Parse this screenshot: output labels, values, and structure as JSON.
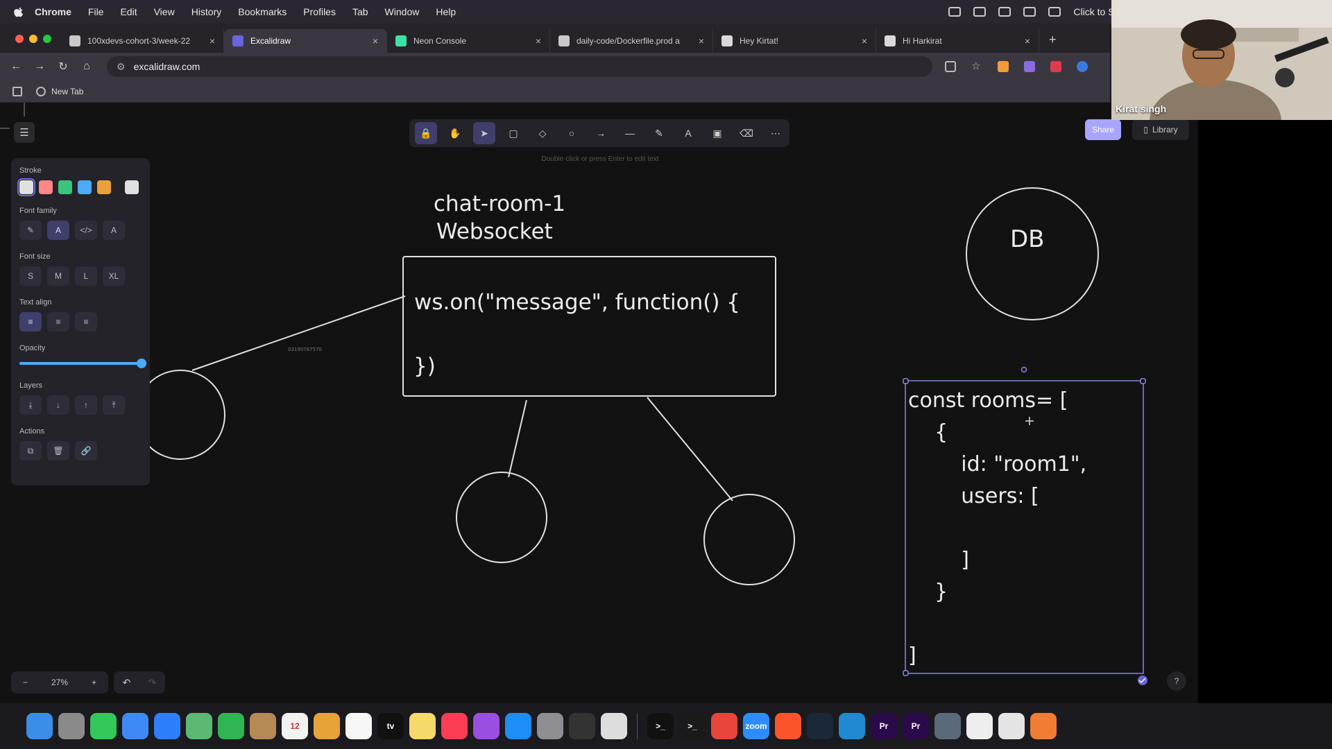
{
  "menubar": {
    "app": "Chrome",
    "items": [
      "File",
      "Edit",
      "View",
      "History",
      "Bookmarks",
      "Profiles",
      "Tab",
      "Window",
      "Help"
    ],
    "sign_in": "Click to Sign in"
  },
  "tabs": [
    {
      "title": "100xdevs-cohort-3/week-22",
      "fav": "#c9c9c9",
      "active": false
    },
    {
      "title": "Excalidraw",
      "fav": "#6965db",
      "active": true
    },
    {
      "title": "Neon Console",
      "fav": "#3ee0a8",
      "active": false
    },
    {
      "title": "daily-code/Dockerfile.prod a",
      "fav": "#c9c9c9",
      "active": false
    },
    {
      "title": "Hey Kirtat!",
      "fav": "#d9d9d9",
      "active": false
    },
    {
      "title": "Hi Harkirat",
      "fav": "#d9d9d9",
      "active": false
    }
  ],
  "address": {
    "url": "excalidraw.com"
  },
  "bookmarks": {
    "item": "New Tab"
  },
  "toolbar": {
    "hint": "Double-click or press Enter to edit text",
    "tools": [
      "lock",
      "hand",
      "selection",
      "rectangle",
      "diamond",
      "ellipse",
      "arrow",
      "line",
      "draw",
      "text",
      "image",
      "eraser",
      "more"
    ]
  },
  "top_right": {
    "share": "Share",
    "library": "Library"
  },
  "properties": {
    "stroke_label": "Stroke",
    "stroke_colors": [
      "#e0e0e0",
      "#ff8787",
      "#3bc47b",
      "#4dabf7",
      "#e8a13c",
      "#e0e0e0"
    ],
    "font_family_label": "Font family",
    "font_size_label": "Font size",
    "font_sizes": [
      "S",
      "M",
      "L",
      "XL"
    ],
    "text_align_label": "Text align",
    "opacity_label": "Opacity",
    "opacity_value": 1.0,
    "layers_label": "Layers",
    "actions_label": "Actions"
  },
  "canvas": {
    "title_line1": "chat-room-1",
    "title_line2": "Websocket",
    "code_line1": "ws.on(\"message\", function() {",
    "code_line2": "})",
    "db_label": "DB",
    "rooms_code": [
      "const rooms= [",
      "    {",
      "        id: \"room1\",",
      "        users: [",
      "",
      "        ]",
      "    }",
      "",
      "]"
    ],
    "tiny_label": "03190767570"
  },
  "bottom": {
    "zoom": "27%",
    "zoom_out": "−",
    "zoom_in": "+",
    "help": "?"
  },
  "webcam": {
    "name": "Kirat singh"
  },
  "dock": {
    "apps": [
      {
        "name": "finder",
        "color": "#3a8ee6",
        "glyph": ""
      },
      {
        "name": "launchpad",
        "color": "#8a8a8a",
        "glyph": ""
      },
      {
        "name": "messages",
        "color": "#34c759",
        "glyph": ""
      },
      {
        "name": "mail",
        "color": "#3d8af7",
        "glyph": ""
      },
      {
        "name": "safari",
        "color": "#2d7ff9",
        "glyph": ""
      },
      {
        "name": "maps",
        "color": "#5bb974",
        "glyph": ""
      },
      {
        "name": "facetime",
        "color": "#2fb553",
        "glyph": ""
      },
      {
        "name": "notes-brown",
        "color": "#b58a55",
        "glyph": ""
      },
      {
        "name": "calendar",
        "color": "#f2f2f2",
        "glyph": "12"
      },
      {
        "name": "photos",
        "color": "#e7a23a",
        "glyph": ""
      },
      {
        "name": "reminders",
        "color": "#f7f7f7",
        "glyph": ""
      },
      {
        "name": "tv",
        "color": "#111111",
        "glyph": "tv"
      },
      {
        "name": "notes",
        "color": "#f5d96b",
        "glyph": ""
      },
      {
        "name": "music",
        "color": "#fa3c55",
        "glyph": ""
      },
      {
        "name": "podcasts",
        "color": "#9b4fe0",
        "glyph": ""
      },
      {
        "name": "app-store",
        "color": "#1e8ef5",
        "glyph": ""
      },
      {
        "name": "settings",
        "color": "#8e8e93",
        "glyph": ""
      },
      {
        "name": "activity",
        "color": "#333333",
        "glyph": ""
      },
      {
        "name": "preview",
        "color": "#dddddd",
        "glyph": ""
      },
      {
        "name": "terminal",
        "color": "#111111",
        "glyph": ">_"
      },
      {
        "name": "terminal-2",
        "color": "#1a1a1a",
        "glyph": ">_"
      },
      {
        "name": "chrome",
        "color": "#e8453c",
        "glyph": ""
      },
      {
        "name": "zoom",
        "color": "#2d8cff",
        "glyph": "zoom"
      },
      {
        "name": "brave",
        "color": "#fb542b",
        "glyph": ""
      },
      {
        "name": "steam",
        "color": "#1b2838",
        "glyph": ""
      },
      {
        "name": "vscode",
        "color": "#1f8ad2",
        "glyph": ""
      },
      {
        "name": "premiere",
        "color": "#2a0a4a",
        "glyph": "Pr"
      },
      {
        "name": "premiere-2",
        "color": "#2a0a4a",
        "glyph": "Pr"
      },
      {
        "name": "quicktime",
        "color": "#5a6a7a",
        "glyph": ""
      },
      {
        "name": "vlc",
        "color": "#eeeeee",
        "glyph": ""
      },
      {
        "name": "white-app",
        "color": "#e4e4e4",
        "glyph": ""
      },
      {
        "name": "orange-app",
        "color": "#f07d31",
        "glyph": ""
      }
    ]
  }
}
